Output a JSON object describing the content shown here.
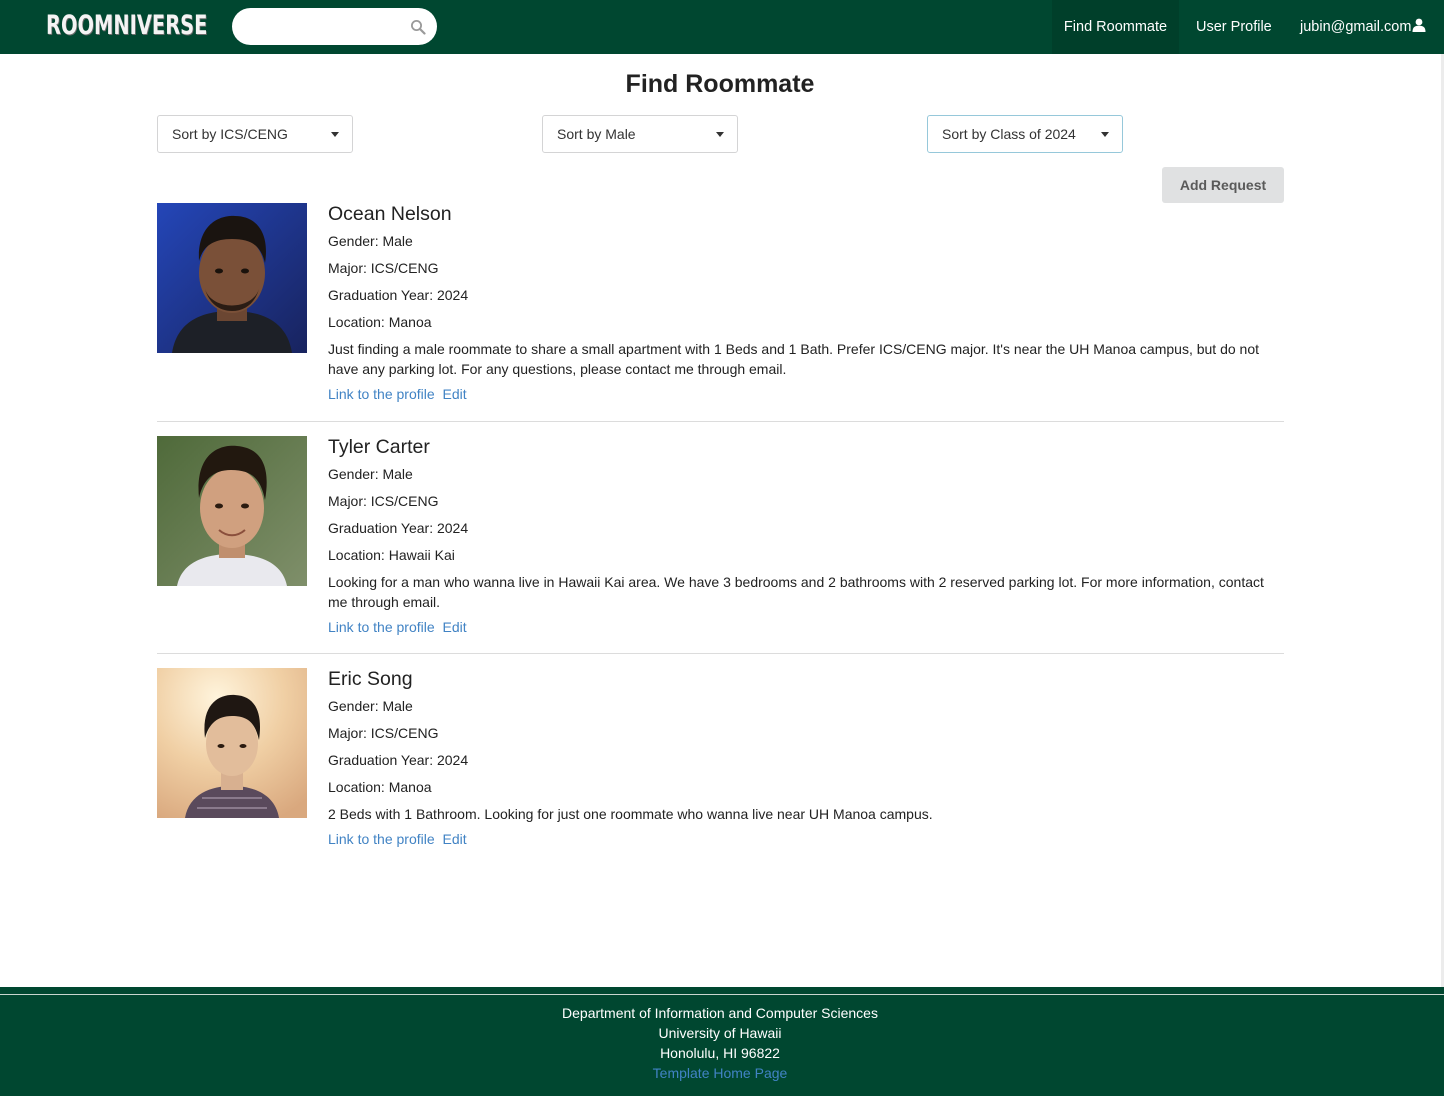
{
  "navbar": {
    "logo": "ROOMNIVERSE",
    "search": {
      "placeholder": "",
      "value": ""
    },
    "items": [
      {
        "label": "Find Roommate",
        "active": true
      },
      {
        "label": "User Profile",
        "active": false
      },
      {
        "label": "jubin@gmail.com",
        "icon": "user-icon"
      }
    ]
  },
  "page": {
    "title": "Find Roommate"
  },
  "filters": [
    {
      "label": "Sort by ICS/CENG"
    },
    {
      "label": "Sort by Male"
    },
    {
      "label": "Sort by Class of 2024",
      "focused": true
    }
  ],
  "actions": {
    "add_request": "Add Request"
  },
  "listings": [
    {
      "name": "Ocean Nelson",
      "gender": "Gender: Male",
      "major": "Major: ICS/CENG",
      "graduation": "Graduation Year: 2024",
      "location": "Location: Manoa",
      "description": "Just finding a male roommate to share a small apartment with 1 Beds and 1 Bath. Prefer ICS/CENG major. It's near the UH Manoa campus, but do not have any parking lot. For any questions, please contact me through email.",
      "profile_link": "Link to the profile",
      "edit_link": "Edit"
    },
    {
      "name": "Tyler Carter",
      "gender": "Gender: Male",
      "major": "Major: ICS/CENG",
      "graduation": "Graduation Year: 2024",
      "location": "Location: Hawaii Kai",
      "description": "Looking for a man who wanna live in Hawaii Kai area. We have 3 bedrooms and 2 bathrooms with 2 reserved parking lot. For more information, contact me through email.",
      "profile_link": "Link to the profile",
      "edit_link": "Edit"
    },
    {
      "name": "Eric Song",
      "gender": "Gender: Male",
      "major": "Major: ICS/CENG",
      "graduation": "Graduation Year: 2024",
      "location": "Location: Manoa",
      "description": "2 Beds with 1 Bathroom. Looking for just one roommate who wanna live near UH Manoa campus.",
      "profile_link": "Link to the profile",
      "edit_link": "Edit"
    }
  ],
  "footer": {
    "line1": "Department of Information and Computer Sciences",
    "line2": "University of Hawaii",
    "line3": "Honolulu, HI 96822",
    "link": "Template Home Page"
  },
  "colors": {
    "brand_green": "#004730",
    "link_blue": "#4183c4",
    "button_grey": "#e0e1e2"
  }
}
